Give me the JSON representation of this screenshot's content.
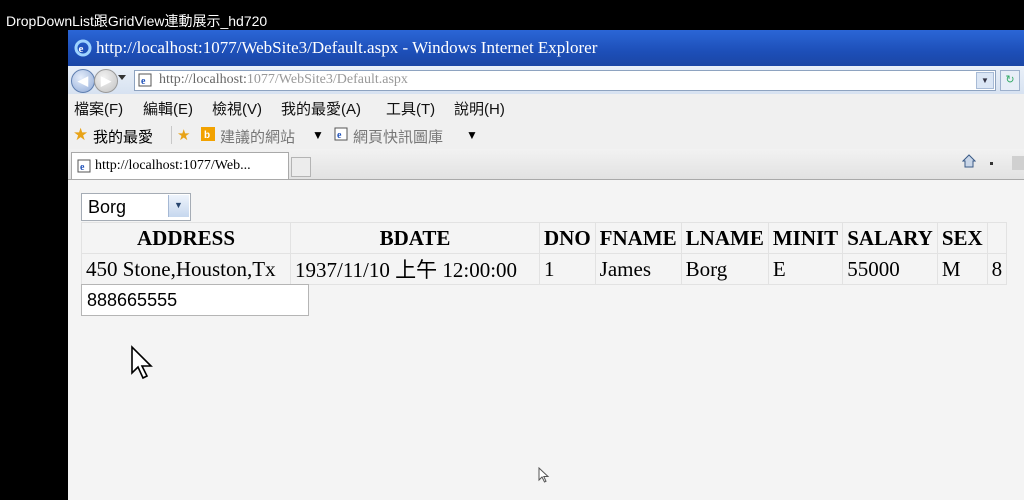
{
  "video_title": "DropDownList跟GridView連動展示_hd720",
  "window": {
    "title": "http://localhost:1077/WebSite3/Default.aspx - Windows Internet Explorer"
  },
  "address": {
    "url_host": "http://localhost:",
    "url_rest": "1077/WebSite3/Default.aspx"
  },
  "menu": [
    "檔案(F)",
    "編輯(E)",
    "檢視(V)",
    "我的最愛(A)",
    "工具(T)",
    "說明(H)"
  ],
  "favorites": {
    "label": "我的最愛",
    "suggested": "建議的網站",
    "web_slice": "網頁快訊圖庫"
  },
  "tab": {
    "label": "http://localhost:1077/Web..."
  },
  "dropdown": {
    "selected": "Borg"
  },
  "grid": {
    "columns": [
      "ADDRESS",
      "BDATE",
      "DNO",
      "FNAME",
      "LNAME",
      "MINIT",
      "SALARY",
      "SEX",
      ""
    ],
    "rows": [
      [
        "450 Stone,Houston,Tx",
        "1937/11/10 上午 12:00:00",
        "1",
        "James",
        "Borg",
        "E",
        "55000",
        "M",
        "8"
      ]
    ]
  },
  "textbox": {
    "value": "888665555"
  },
  "colors": {
    "titlebar": "#1d4fb8",
    "accent": "#2b66d6"
  },
  "icons": [
    "ie-logo-icon",
    "back-icon",
    "forward-icon",
    "page-icon",
    "refresh-icon",
    "star-icon",
    "suggested-sites-icon",
    "web-slice-icon",
    "home-icon",
    "feeds-icon",
    "dropdown-arrow-icon",
    "mouse-cursor-icon"
  ]
}
